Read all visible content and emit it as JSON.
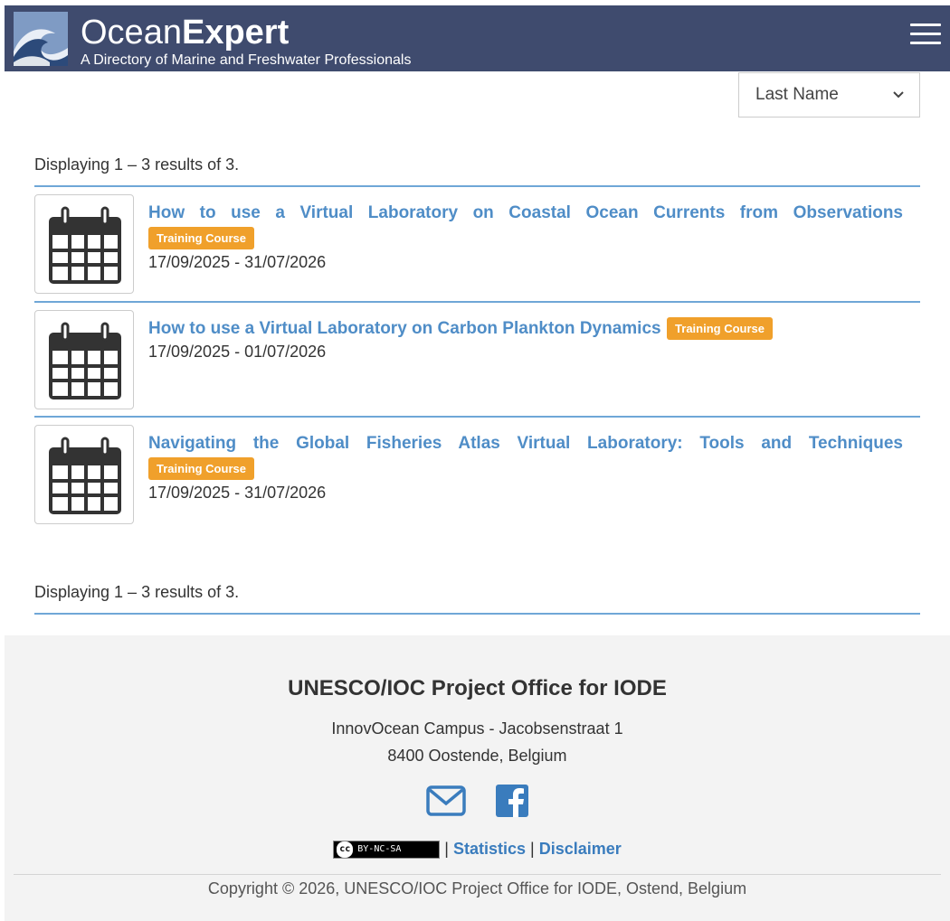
{
  "header": {
    "brand_regular": "Ocean",
    "brand_bold": "Expert",
    "tagline": "A Directory of Marine and Freshwater Professionals",
    "color": "#3f4b6e"
  },
  "sort": {
    "selected": "Last Name"
  },
  "summary": {
    "text": "Displaying 1 – 3 results of 3."
  },
  "results": [
    {
      "title": "How to use a Virtual Laboratory on Coastal Ocean Currents from Observations",
      "badge": "Training Course",
      "dates": "17/09/2025 - 31/07/2026"
    },
    {
      "title": "How to use a Virtual Laboratory on Carbon Plankton Dynamics",
      "badge": "Training Course",
      "dates": "17/09/2025 - 01/07/2026"
    },
    {
      "title": "Navigating the Global Fisheries Atlas Virtual Laboratory: Tools and Techniques",
      "badge": "Training Course",
      "dates": "17/09/2025 - 31/07/2026"
    }
  ],
  "footer": {
    "title": "UNESCO/IOC Project Office for IODE",
    "address_line1": "InnovOcean Campus - Jacobsenstraat 1",
    "address_line2": "8400 Oostende, Belgium",
    "icons": [
      "envelope-icon",
      "facebook-icon"
    ],
    "license_badge": "BY-NC-SA",
    "license_cc": "cc",
    "separator": "|",
    "statistics_label": "Statistics",
    "disclaimer_label": "Disclaimer",
    "copyright": "Copyright © 2026, UNESCO/IOC Project Office for IODE, Ostend, Belgium"
  },
  "colors": {
    "link": "#4f8dc7",
    "badge": "#f0a02b",
    "rule": "#6fa7d7"
  }
}
